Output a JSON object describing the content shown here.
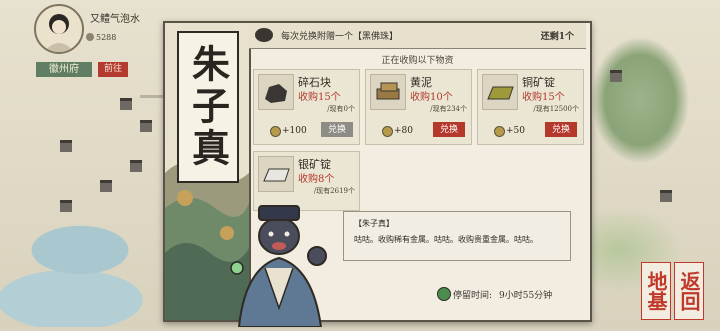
{
  "player": {
    "name": "又鳢气泡水",
    "money": "5288"
  },
  "city": {
    "name": "徽州府",
    "action_label": "前往"
  },
  "npc": {
    "title": "朱子真"
  },
  "banner": {
    "text": "每次兑换附赠一个【黑佛珠】",
    "remaining": "还剩1个"
  },
  "subheading": "正在收购以下物资",
  "items": [
    {
      "name": "碎石块",
      "price": "收购15个",
      "stock": "/现有0个",
      "reputation": "+100",
      "button": "兑换",
      "enabled": false,
      "icon": "rock-icon"
    },
    {
      "name": "黄泥",
      "price": "收购10个",
      "stock": "/现有234个",
      "reputation": "+80",
      "button": "兑换",
      "enabled": true,
      "icon": "clay-icon"
    },
    {
      "name": "铜矿锭",
      "price": "收购15个",
      "stock": "/现有12500个",
      "reputation": "+50",
      "button": "兑换",
      "enabled": true,
      "icon": "copper-ingot-icon"
    },
    {
      "name": "银矿锭",
      "price": "收购8个",
      "stock": "/现有2619个",
      "reputation": "",
      "button": "",
      "enabled": true,
      "icon": "silver-ingot-icon"
    }
  ],
  "dialog": {
    "speaker": "【朱子真】",
    "text": "咕咕。收购稀有金属。咕咕。收购贵重金属。咕咕。"
  },
  "stay": {
    "label": "停留时间:",
    "value": "9小时55分钟"
  },
  "side_buttons": {
    "return": "返回",
    "base": "地基"
  },
  "colors": {
    "accent_red": "#b5382c",
    "disabled_gray": "#8f8c86",
    "panel_bg": "#f2ede0"
  }
}
